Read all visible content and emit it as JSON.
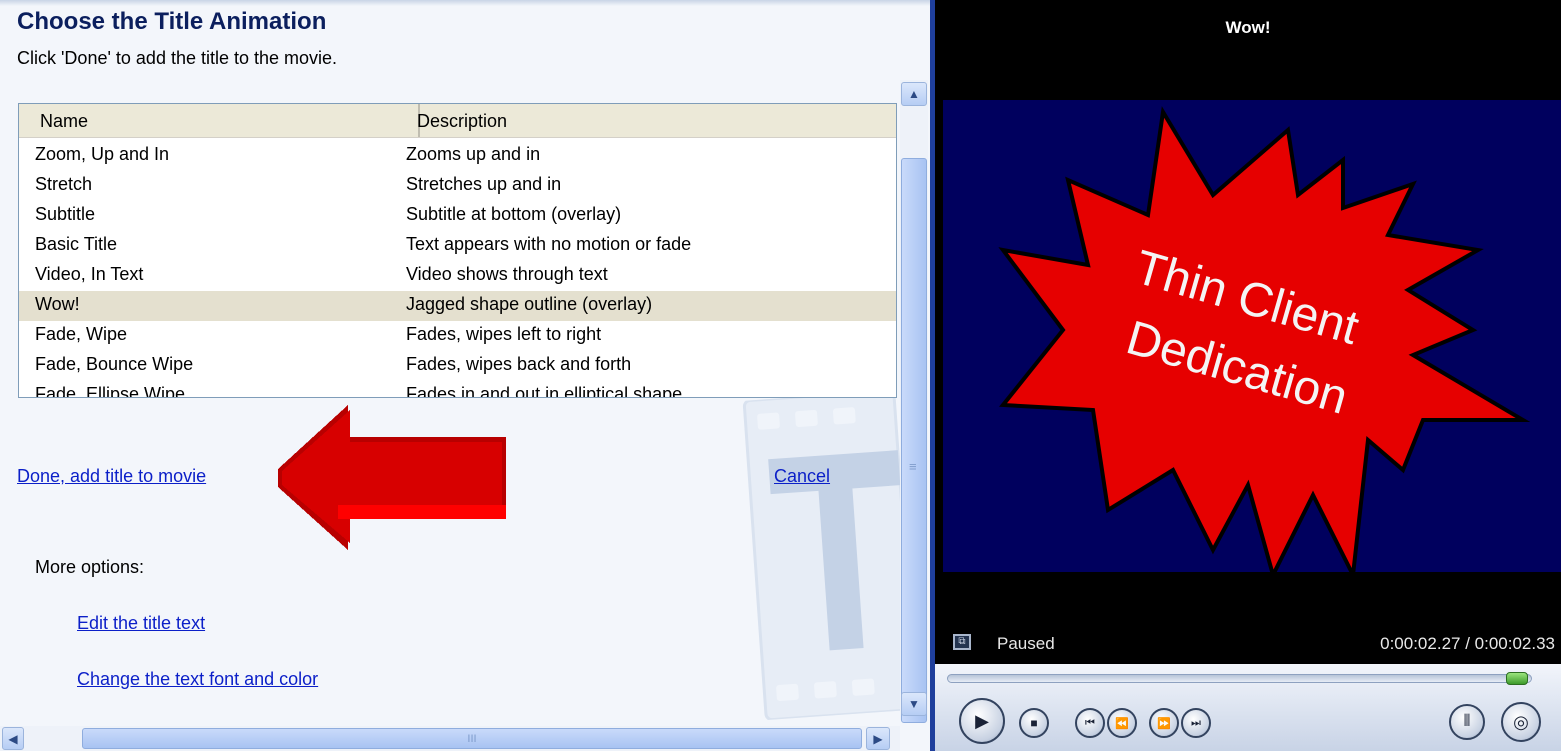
{
  "panel": {
    "title": "Choose the Title Animation",
    "subtitle": "Click 'Done' to add the title to the movie."
  },
  "animation_list": {
    "columns": {
      "name": "Name",
      "description": "Description"
    },
    "rows": [
      {
        "name": "Zoom, Up and In",
        "description": "Zooms up and in"
      },
      {
        "name": "Stretch",
        "description": "Stretches up and in"
      },
      {
        "name": "Subtitle",
        "description": "Subtitle at bottom (overlay)"
      },
      {
        "name": "Basic Title",
        "description": "Text appears with no motion or fade"
      },
      {
        "name": "Video, In Text",
        "description": "Video shows through text"
      },
      {
        "name": "Wow!",
        "description": "Jagged shape outline (overlay)",
        "selected": true
      },
      {
        "name": "Fade, Wipe",
        "description": "Fades, wipes left to right"
      },
      {
        "name": "Fade, Bounce Wipe",
        "description": "Fades, wipes back and forth"
      },
      {
        "name": "Fade, Ellipse Wipe",
        "description": "Fades in and out in elliptical shape"
      }
    ]
  },
  "actions": {
    "done": "Done, add title to movie",
    "cancel": "Cancel",
    "more_options_label": "More options:",
    "edit_title": "Edit the title text",
    "change_font": "Change the text font and color"
  },
  "player": {
    "clip_title": "Wow!",
    "preview_text_line1": "Thin Client",
    "preview_text_line2": "Dedication",
    "status": "Paused",
    "time": "0:00:02.27 / 0:00:02.33",
    "progress_fraction": 0.974
  },
  "colors": {
    "link": "#0b1fc8",
    "title_navy": "#0b1f5e",
    "selection": "#e4e0cf",
    "preview_background": "#00005e",
    "starburst": "#e60000",
    "arrow": "#c00000"
  },
  "icons": {
    "scroll_up": "▲",
    "scroll_down": "▼",
    "scroll_left": "◀",
    "scroll_right": "▶",
    "grip": "III",
    "grip_vertical": "≡",
    "fullscreen": "⧉",
    "play": "▶",
    "stop": "■",
    "previous": "⏮",
    "rewind": "⏪",
    "forward": "⏩",
    "next": "⏭",
    "split": "⫴",
    "camera": "◎"
  }
}
